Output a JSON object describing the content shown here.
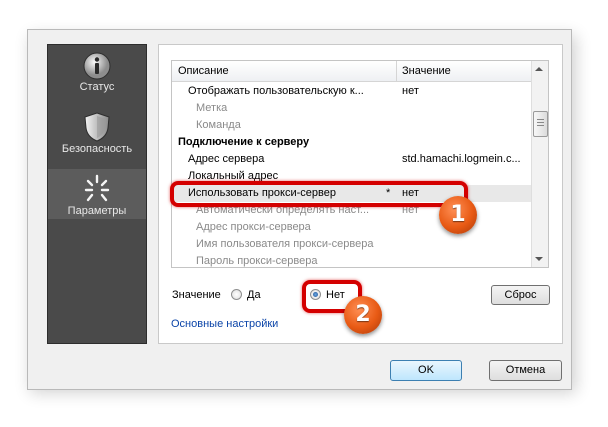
{
  "sidebar": {
    "items": [
      {
        "label": "Статус",
        "icon": "info-icon"
      },
      {
        "label": "Безопасность",
        "icon": "shield-icon"
      },
      {
        "label": "Параметры",
        "icon": "settings-sparkle-icon",
        "active": true
      }
    ]
  },
  "list": {
    "columns": [
      "Описание",
      "Значение"
    ],
    "rows": [
      {
        "label": "Отображать пользовательскую к...",
        "value": "нет"
      },
      {
        "label": "Метка",
        "value": ""
      },
      {
        "label": "Команда",
        "value": ""
      },
      {
        "label": "Подключение к серверу",
        "value": ""
      },
      {
        "label": "Адрес сервера",
        "value": "std.hamachi.logmein.c..."
      },
      {
        "label": "Локальный адрес",
        "value": ""
      },
      {
        "label": "Использовать прокси-сервер",
        "marker": "*",
        "value": "нет"
      },
      {
        "label": "Автоматически определять наст...",
        "value": "нет"
      },
      {
        "label": "Адрес прокси-сервера",
        "value": ""
      },
      {
        "label": "Имя пользователя прокси-сервера",
        "value": ""
      },
      {
        "label": "Пароль прокси-сервера",
        "value": ""
      }
    ]
  },
  "value_editor": {
    "label": "Значение",
    "option_yes": "Да",
    "option_no": "Нет",
    "selected": "Нет",
    "reset_label": "Сброс"
  },
  "basic_settings_link": "Основные настройки",
  "footer": {
    "ok_label": "OK",
    "cancel_label": "Отмена"
  },
  "annotations": {
    "badge_1": "1",
    "badge_2": "2",
    "highlight_color": "#d40000",
    "badge_color": "#e85a14"
  },
  "colors": {
    "sidebar_bg": "#4a4a4a",
    "link": "#0b44a8"
  }
}
